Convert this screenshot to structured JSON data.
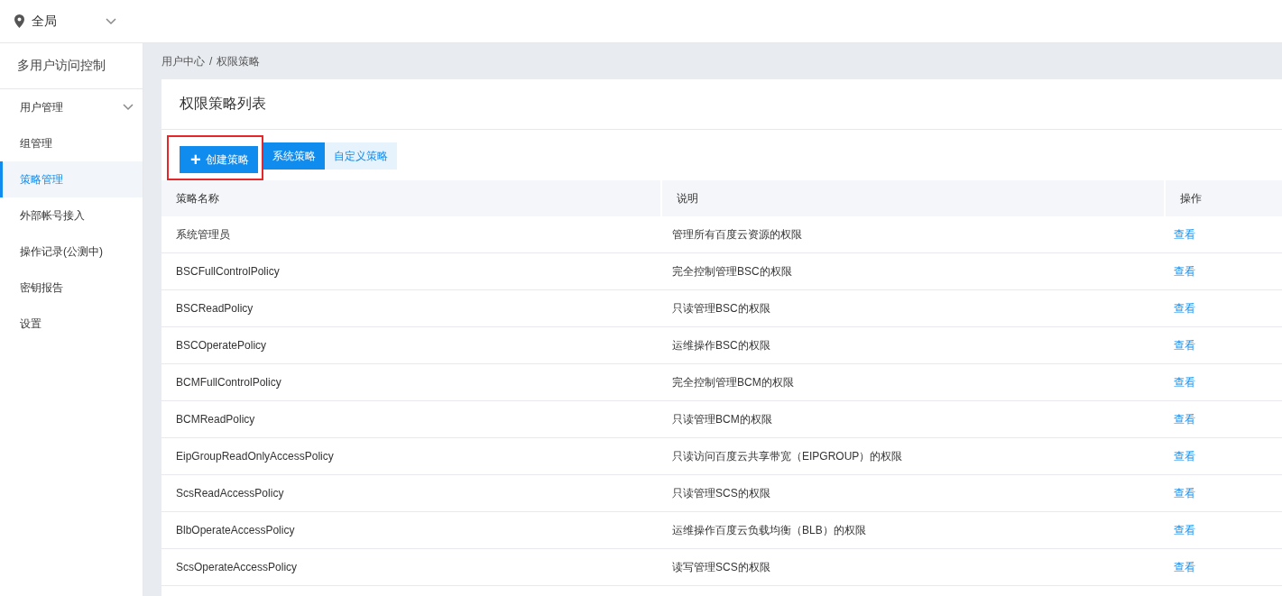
{
  "region": {
    "label": "全局"
  },
  "sidebar": {
    "title": "多用户访问控制",
    "items": [
      {
        "label": "用户管理",
        "selected": false,
        "expandable": true
      },
      {
        "label": "组管理",
        "selected": false,
        "expandable": false
      },
      {
        "label": "策略管理",
        "selected": true,
        "expandable": false
      },
      {
        "label": "外部帐号接入",
        "selected": false,
        "expandable": false
      },
      {
        "label": "操作记录(公测中)",
        "selected": false,
        "expandable": false
      },
      {
        "label": "密钥报告",
        "selected": false,
        "expandable": false
      },
      {
        "label": "设置",
        "selected": false,
        "expandable": false
      }
    ]
  },
  "breadcrumb": [
    "用户中心",
    "权限策略"
  ],
  "breadcrumb_separator": "/",
  "card": {
    "title": "权限策略列表",
    "create_button": {
      "icon": "+",
      "label": "创建策略",
      "highlighted": true
    },
    "tabs": [
      {
        "label": "系统策略",
        "selected": true
      },
      {
        "label": "自定义策略",
        "selected": false
      }
    ],
    "table": {
      "columns": [
        "策略名称",
        "说明",
        "操作"
      ],
      "rows": [
        {
          "name": "系统管理员",
          "description": "管理所有百度云资源的权限",
          "action": "查看"
        },
        {
          "name": "BSCFullControlPolicy",
          "description": "完全控制管理BSC的权限",
          "action": "查看"
        },
        {
          "name": "BSCReadPolicy",
          "description": "只读管理BSC的权限",
          "action": "查看"
        },
        {
          "name": "BSCOperatePolicy",
          "description": "运维操作BSC的权限",
          "action": "查看"
        },
        {
          "name": "BCMFullControlPolicy",
          "description": "完全控制管理BCM的权限",
          "action": "查看"
        },
        {
          "name": "BCMReadPolicy",
          "description": "只读管理BCM的权限",
          "action": "查看"
        },
        {
          "name": "EipGroupReadOnlyAccessPolicy",
          "description": "只读访问百度云共享带宽（EIPGROUP）的权限",
          "action": "查看"
        },
        {
          "name": "ScsReadAccessPolicy",
          "description": "只读管理SCS的权限",
          "action": "查看"
        },
        {
          "name": "BlbOperateAccessPolicy",
          "description": "运维操作百度云负载均衡（BLB）的权限",
          "action": "查看"
        },
        {
          "name": "ScsOperateAccessPolicy",
          "description": "读写管理SCS的权限",
          "action": "查看"
        }
      ]
    }
  }
}
